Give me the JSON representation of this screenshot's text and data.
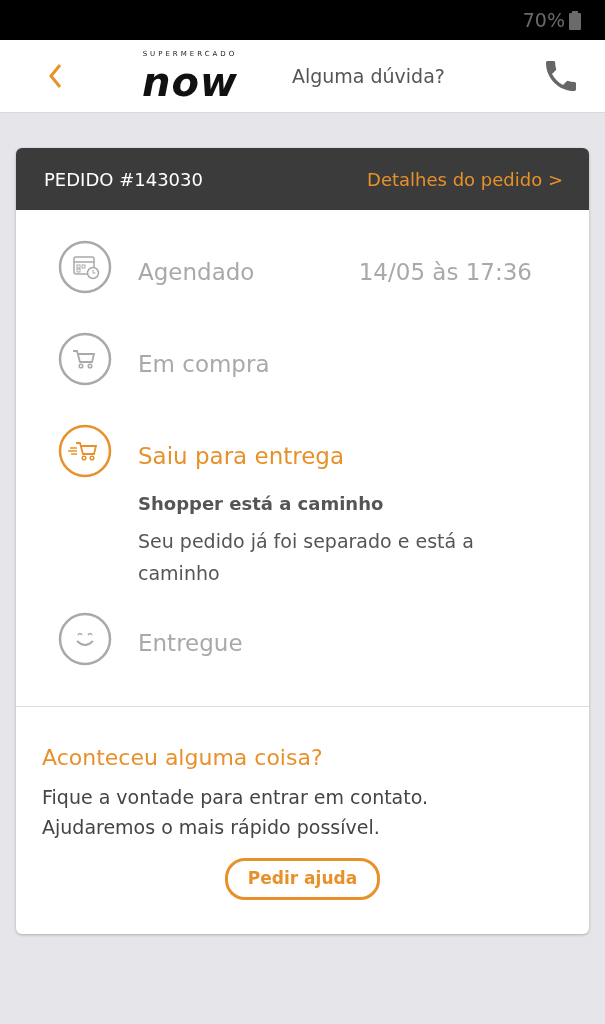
{
  "status_bar": {
    "battery": "70%"
  },
  "header": {
    "logo_top": "SUPERMERCADO",
    "logo_word": "now",
    "help_text": "Alguma dúvida?"
  },
  "order": {
    "title": "PEDIDO #143030",
    "details_link": "Detalhes do pedido >"
  },
  "steps": [
    {
      "kind": "calendar",
      "label": "Agendado",
      "time": "14/05 às 17:36",
      "active": false
    },
    {
      "kind": "cart",
      "label": "Em compra",
      "active": false
    },
    {
      "kind": "delivery",
      "label": "Saiu para entrega",
      "active": true,
      "detail_title": "Shopper está a caminho",
      "detail_text": "Seu pedido já foi separado e está a caminho"
    },
    {
      "kind": "smile",
      "label": "Entregue",
      "active": false
    }
  ],
  "help": {
    "title": "Aconteceu alguma coisa?",
    "text": "Fique a vontade para entrar em contato. Ajudaremos o mais rápido possível.",
    "button": "Pedir ajuda"
  }
}
